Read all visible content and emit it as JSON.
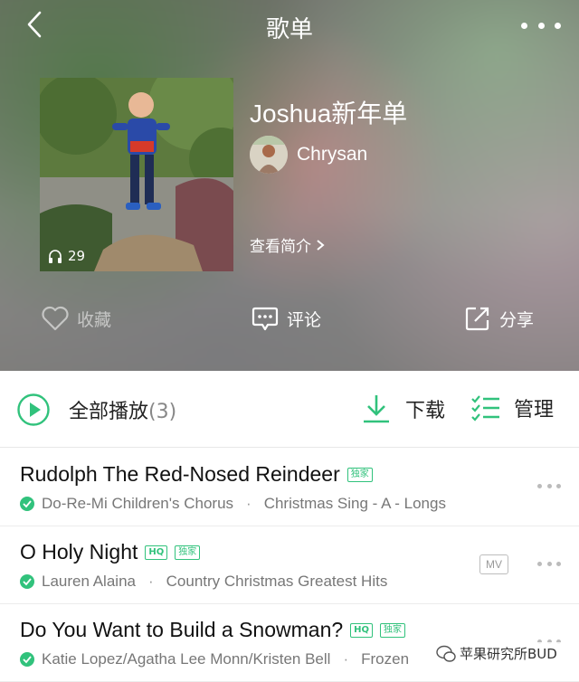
{
  "header": {
    "title": "歌单",
    "back_icon": "chevron-left-icon",
    "more_icon": "more-dots-icon"
  },
  "playlist": {
    "name": "Joshua新年单",
    "play_count": "29",
    "creator_name": "Chrysan",
    "view_intro_label": "查看简介"
  },
  "actions": {
    "favorite_label": "收藏",
    "comment_label": "评论",
    "share_label": "分享"
  },
  "list_toolbar": {
    "play_all_label": "全部播放",
    "play_all_count": "(3)",
    "download_label": "下载",
    "manage_label": "管理"
  },
  "songs": [
    {
      "title": "Rudolph The Red-Nosed Reindeer",
      "tags": [
        "独家"
      ],
      "artist": "Do-Re-Mi Children's Chorus",
      "album": "Christmas Sing - A - Longs",
      "has_mv": false
    },
    {
      "title": "O Holy Night",
      "tags": [
        "HQ",
        "独家"
      ],
      "artist": "Lauren Alaina",
      "album": "Country Christmas Greatest Hits",
      "has_mv": true,
      "mv_label": "MV"
    },
    {
      "title": "Do You Want to Build a Snowman?",
      "tags": [
        "HQ",
        "独家"
      ],
      "artist": "Katie Lopez/Agatha Lee Monn/Kristen Bell",
      "album": "Frozen",
      "has_mv": false
    }
  ],
  "watermark": {
    "text": "苹果研究所BUD"
  },
  "colors": {
    "accent_green": "#31c27c",
    "text_primary": "#222222",
    "text_secondary": "#777777"
  }
}
